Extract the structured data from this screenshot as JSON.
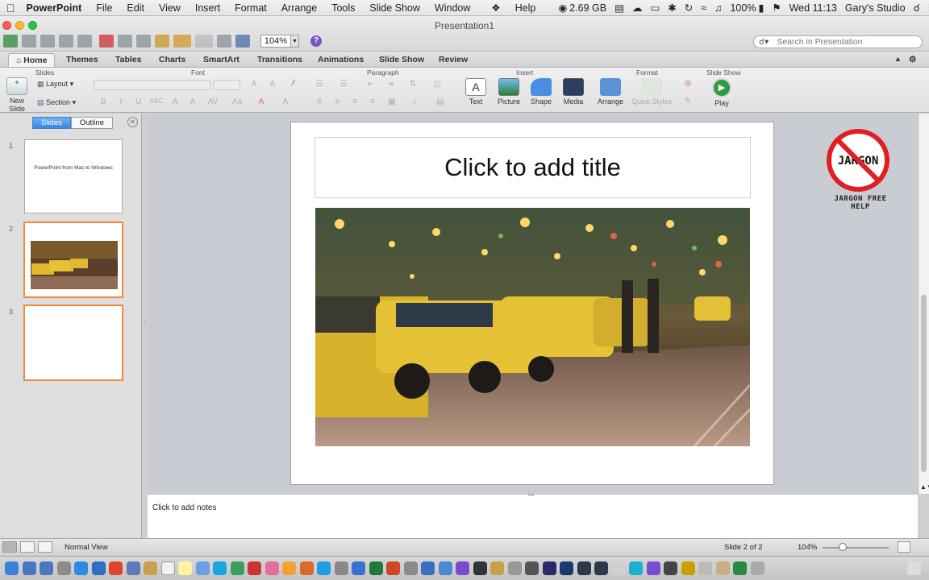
{
  "menubar": {
    "app": "PowerPoint",
    "items": [
      "File",
      "Edit",
      "View",
      "Insert",
      "Format",
      "Arrange",
      "Tools",
      "Slide Show",
      "Window",
      "Help"
    ],
    "memory": "2.69 GB",
    "battery": "100%",
    "clock": "Wed 11:13",
    "user": "Gary's Studio"
  },
  "window": {
    "title": "Presentation1",
    "zoom": "104%",
    "search_placeholder": "Search in Presentation"
  },
  "ribbon": {
    "tabs": [
      "Home",
      "Themes",
      "Tables",
      "Charts",
      "SmartArt",
      "Transitions",
      "Animations",
      "Slide Show",
      "Review"
    ],
    "active_tab": "Home",
    "groups": {
      "slides": "Slides",
      "font": "Font",
      "paragraph": "Paragraph",
      "insert": "Insert",
      "format": "Format",
      "slideshow": "Slide Show"
    },
    "slides_group": {
      "new_slide": "New Slide",
      "layout": "Layout",
      "section": "Section"
    },
    "insert_group": {
      "text": "Text",
      "picture": "Picture",
      "shape": "Shape",
      "media": "Media"
    },
    "format_group": {
      "arrange": "Arrange",
      "quick_styles": "Quick Styles"
    },
    "slideshow_group": {
      "play": "Play"
    }
  },
  "leftpane": {
    "seg_slides": "Slides",
    "seg_outline": "Outline",
    "thumbs": [
      {
        "num": "1",
        "title": "PowerPoint from Mac to Windows"
      },
      {
        "num": "2"
      },
      {
        "num": "3"
      }
    ]
  },
  "slide": {
    "title_placeholder": "Click to add title"
  },
  "logo": {
    "tagline": "JARGON FREE HELP",
    "badge_text": "JARGON"
  },
  "notes": {
    "placeholder": "Click to add notes"
  },
  "status": {
    "view": "Normal View",
    "slide_pos": "Slide 2 of 2",
    "zoom": "104%"
  },
  "accent": "#f08a3a"
}
